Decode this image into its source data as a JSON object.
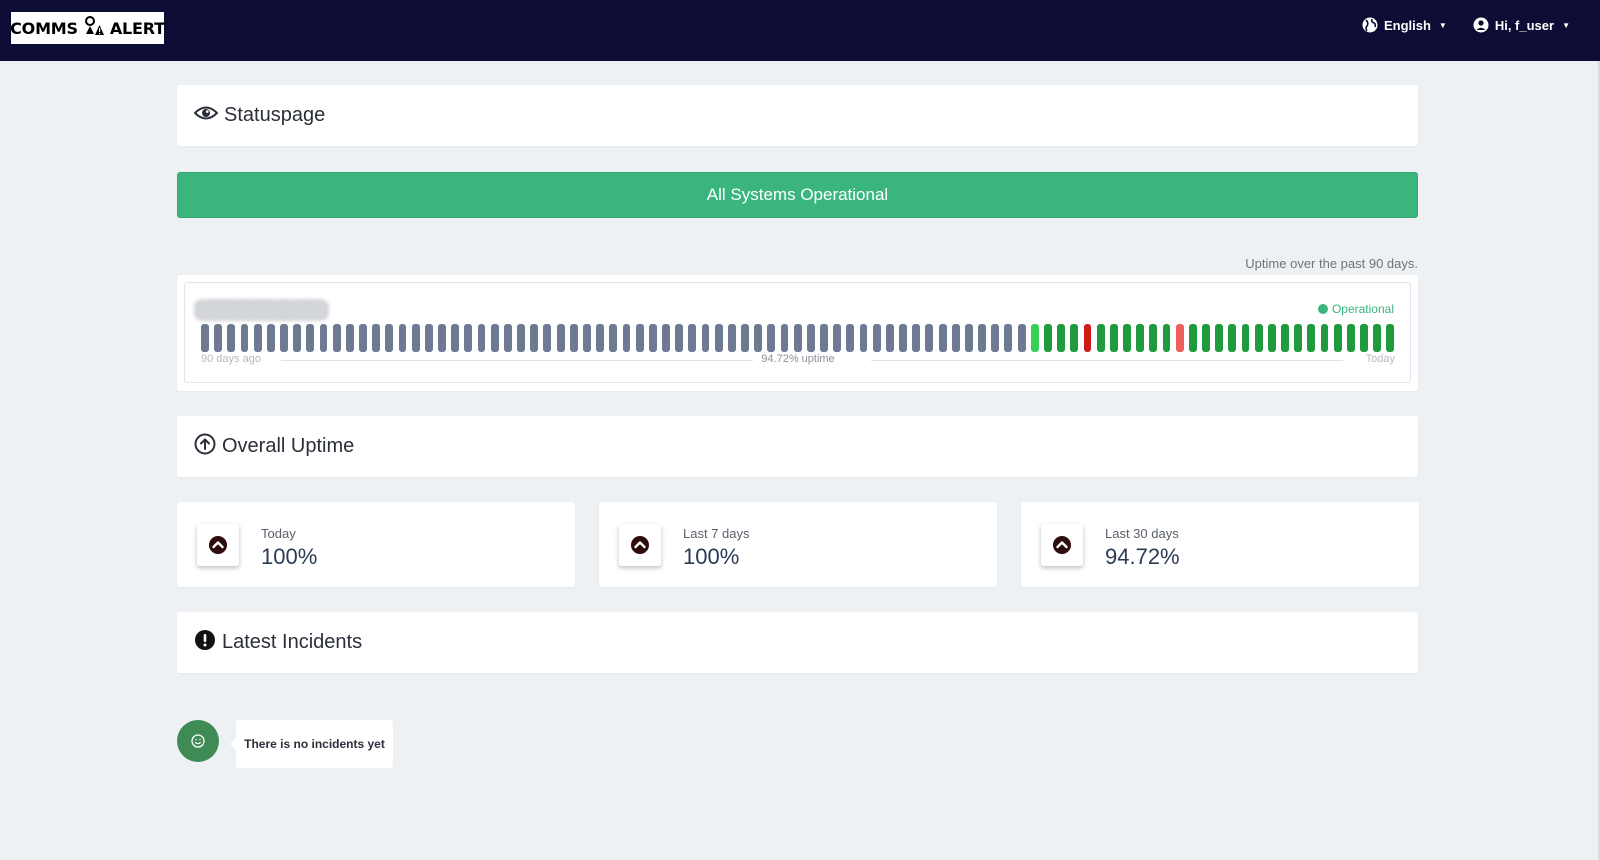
{
  "navbar": {
    "logo_left": "COMMS",
    "logo_right": "ALERT",
    "logo_icon": "alert-person-icon",
    "language": "English",
    "user": "Hi, f_user"
  },
  "statuspage": {
    "title": "Statuspage"
  },
  "status_banner": {
    "text": "All Systems Operational",
    "color": "#3ab57e"
  },
  "uptime": {
    "caption": "Uptime over the past 90 days.",
    "legend": "Operational",
    "left_label": "90 days ago",
    "center_label": "94.72% uptime",
    "right_label": "Today",
    "bars": [
      "nodata",
      "nodata",
      "nodata",
      "nodata",
      "nodata",
      "nodata",
      "nodata",
      "nodata",
      "nodata",
      "nodata",
      "nodata",
      "nodata",
      "nodata",
      "nodata",
      "nodata",
      "nodata",
      "nodata",
      "nodata",
      "nodata",
      "nodata",
      "nodata",
      "nodata",
      "nodata",
      "nodata",
      "nodata",
      "nodata",
      "nodata",
      "nodata",
      "nodata",
      "nodata",
      "nodata",
      "nodata",
      "nodata",
      "nodata",
      "nodata",
      "nodata",
      "nodata",
      "nodata",
      "nodata",
      "nodata",
      "nodata",
      "nodata",
      "nodata",
      "nodata",
      "nodata",
      "nodata",
      "nodata",
      "nodata",
      "nodata",
      "nodata",
      "nodata",
      "nodata",
      "nodata",
      "nodata",
      "nodata",
      "nodata",
      "nodata",
      "nodata",
      "nodata",
      "nodata",
      "nodata",
      "nodata",
      "nodata",
      "light",
      "ok",
      "ok",
      "ok",
      "down",
      "ok",
      "ok",
      "ok",
      "ok",
      "ok",
      "ok",
      "partial",
      "ok",
      "ok",
      "ok",
      "ok",
      "ok",
      "ok",
      "ok",
      "ok",
      "ok",
      "ok",
      "ok",
      "ok",
      "ok",
      "ok",
      "ok",
      "ok"
    ],
    "colors": {
      "nodata": "#6e7a91",
      "ok": "#1f9a3c",
      "light": "#39d05a",
      "down": "#d01b1b",
      "partial": "#ee5f5b"
    }
  },
  "overall_uptime": {
    "title": "Overall Uptime",
    "metrics": [
      {
        "label": "Today",
        "value": "100%"
      },
      {
        "label": "Last 7 days",
        "value": "100%"
      },
      {
        "label": "Last 30 days",
        "value": "94.72%"
      }
    ]
  },
  "incidents": {
    "title": "Latest Incidents",
    "empty_text": "There is no incidents yet"
  }
}
